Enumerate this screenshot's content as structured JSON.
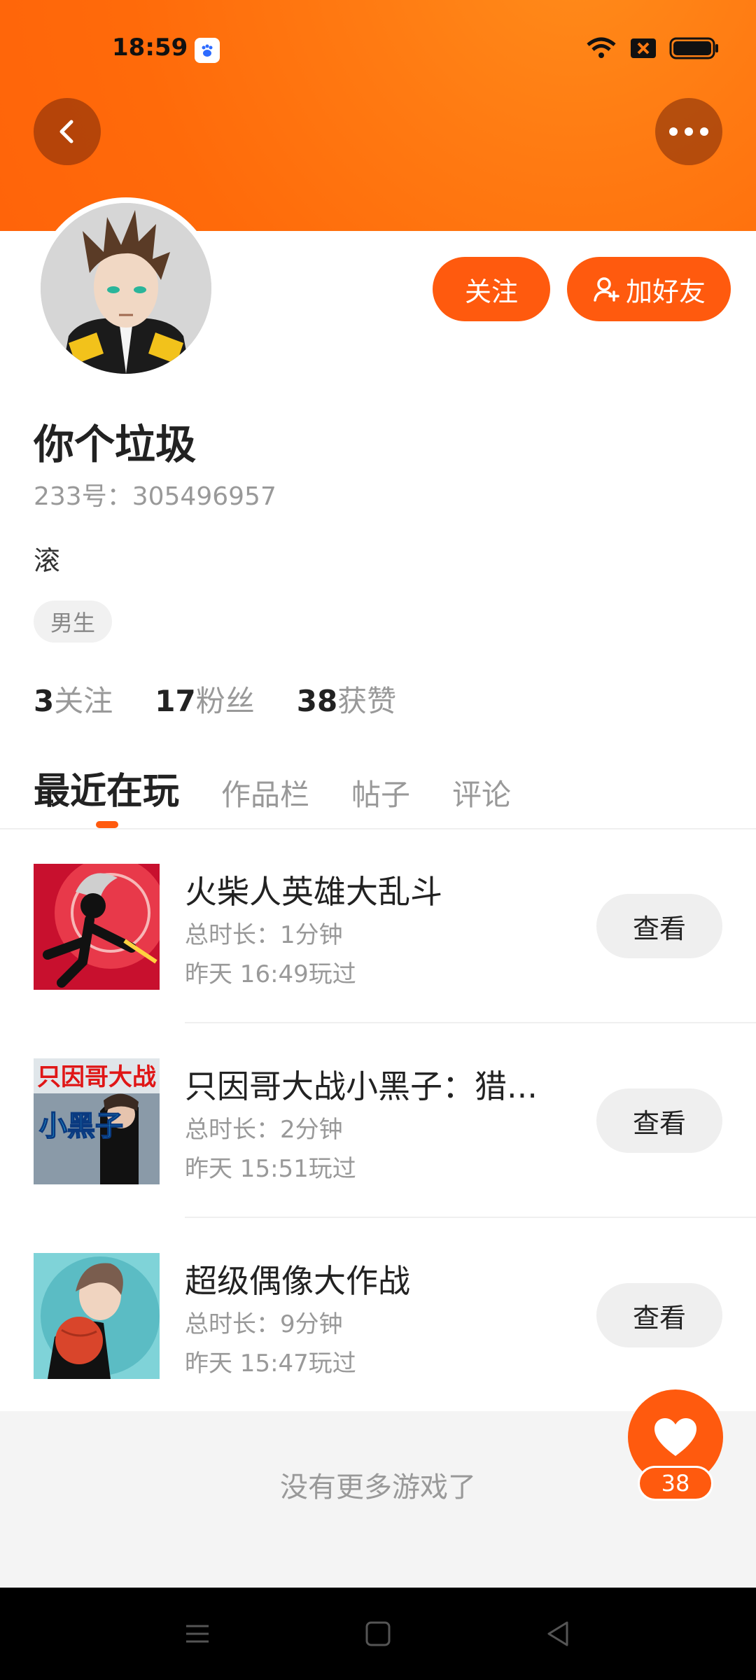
{
  "status_bar": {
    "time": "18:59"
  },
  "profile": {
    "username": "你个垃圾",
    "uid": "233号：305496957",
    "bio": "滚",
    "gender": "男生",
    "follow_label": "关注",
    "add_friend_label": "加好友"
  },
  "stats": [
    {
      "count": "3",
      "label": "关注"
    },
    {
      "count": "17",
      "label": "粉丝"
    },
    {
      "count": "38",
      "label": "获赞"
    }
  ],
  "tabs": [
    {
      "label": "最近在玩",
      "active": true
    },
    {
      "label": "作品栏",
      "active": false
    },
    {
      "label": "帖子",
      "active": false
    },
    {
      "label": "评论",
      "active": false
    }
  ],
  "games": [
    {
      "title": "火柴人英雄大乱斗",
      "duration": "总时长：1分钟",
      "last_played": "昨天 16:49玩过",
      "action": "查看"
    },
    {
      "title": "只因哥大战小黑子：猎...",
      "duration": "总时长：2分钟",
      "last_played": "昨天 15:51玩过",
      "action": "查看"
    },
    {
      "title": "超级偶像大作战",
      "duration": "总时长：9分钟",
      "last_played": "昨天 15:47玩过",
      "action": "查看"
    }
  ],
  "game_thumb_texts": {
    "g2_line1": "只因哥大战",
    "g2_line2": "小黑子"
  },
  "footer": {
    "no_more": "没有更多游戏了"
  },
  "like_fab": {
    "count": "38"
  },
  "colors": {
    "accent": "#ff5a0e",
    "header": "#ff7a12"
  }
}
